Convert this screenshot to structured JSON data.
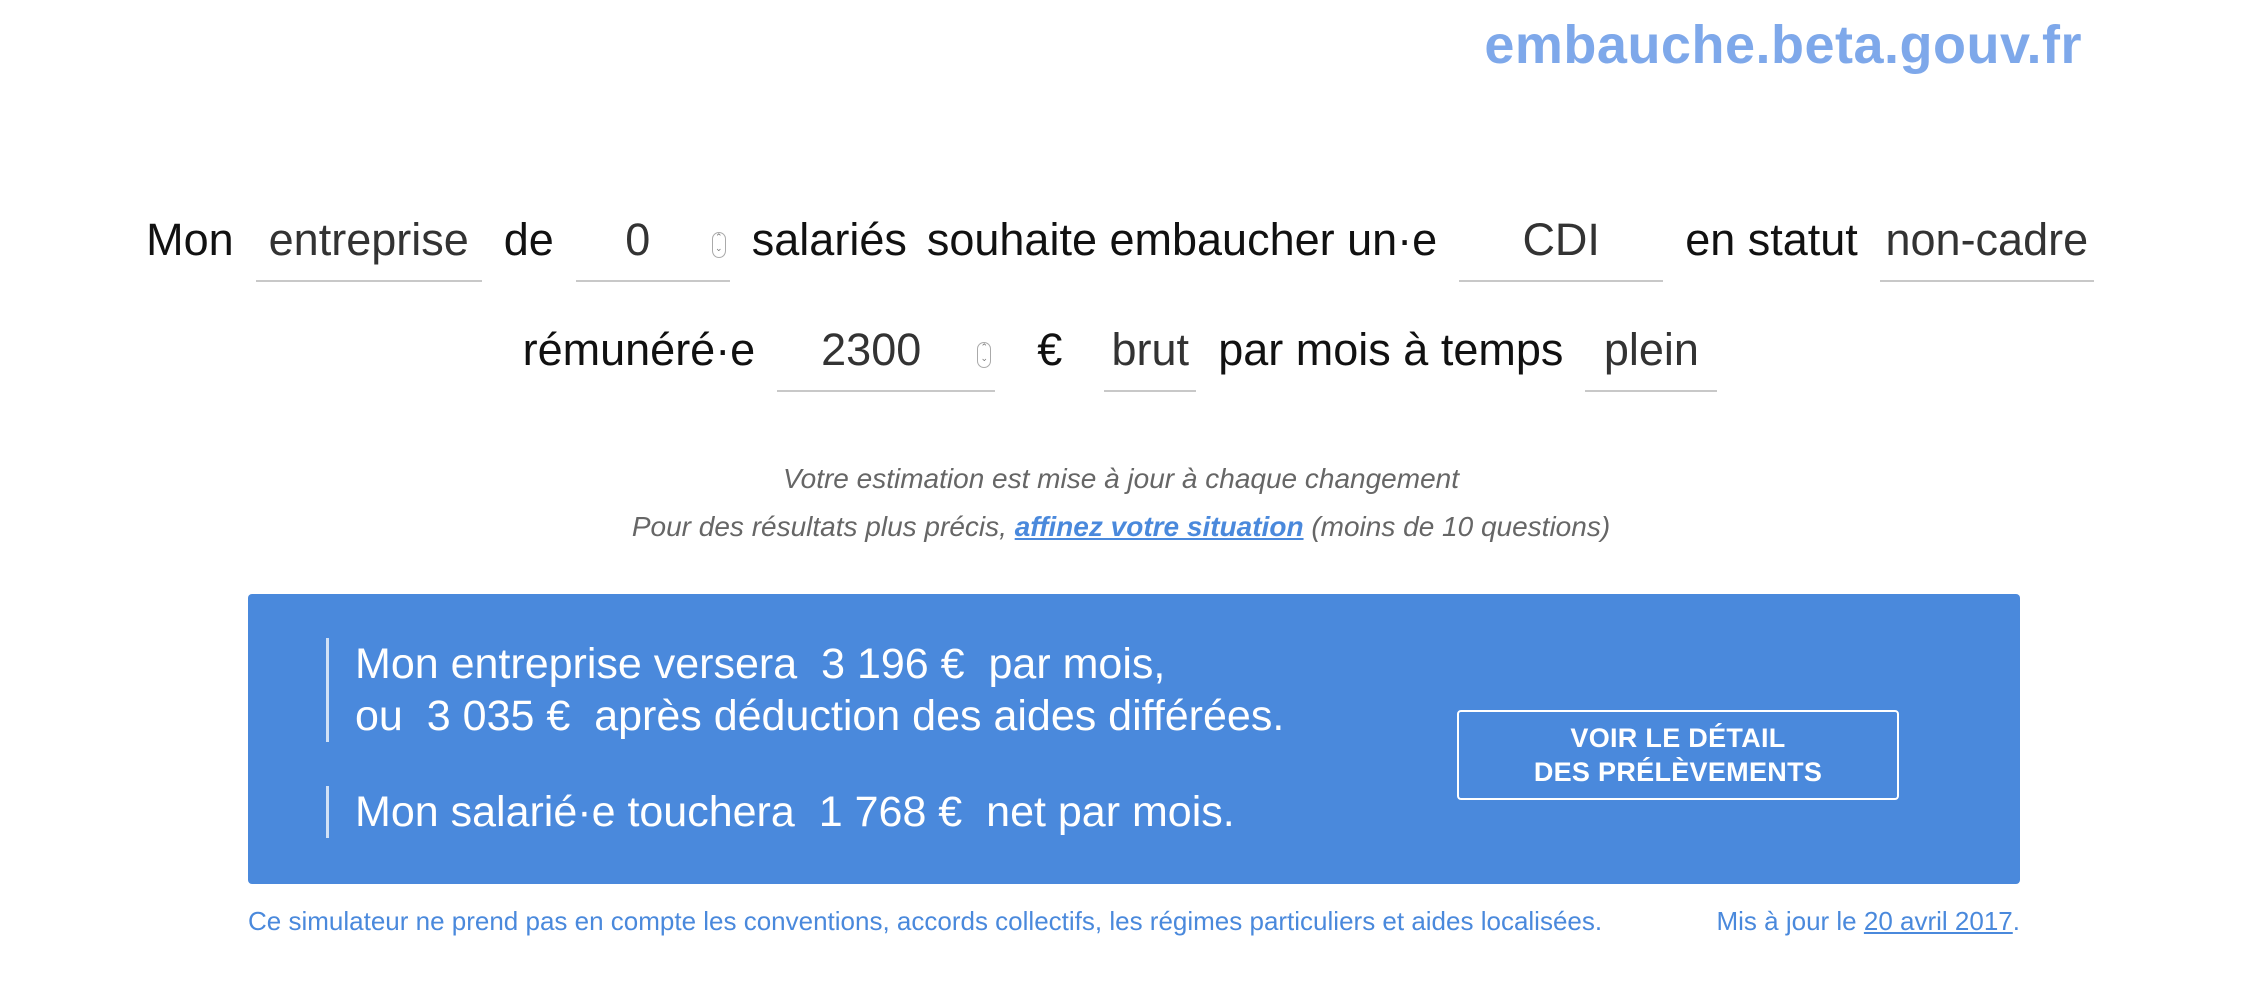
{
  "header": {
    "site_link": "embauche.beta.gouv.fr"
  },
  "sentence": {
    "mon": "Mon",
    "company_type": "entreprise",
    "de": "de",
    "employees": "0",
    "salaries": "salariés",
    "souhaite": "souhaite embaucher un·e",
    "contract": "CDI",
    "en_statut": "en statut",
    "status": "non-cadre",
    "remunere": "rémunéré·e",
    "salary": "2300",
    "currency": "€",
    "salary_type": "brut",
    "par_mois": "par mois à temps",
    "time": "plein"
  },
  "notes": {
    "line1": "Votre estimation est mise à jour à chaque changement",
    "line2_before": "Pour des résultats plus précis,",
    "line2_link": "affinez votre situation",
    "line2_after": "(moins de 10 questions)"
  },
  "result": {
    "line1_prefix": "Mon entreprise versera",
    "line1_amount": "3 196 €",
    "line1_suffix": "par mois,",
    "line2_prefix": "ou",
    "line2_amount": "3 035 €",
    "line2_suffix": "après déduction des aides différées.",
    "line3_prefix": "Mon salarié·e touchera",
    "line3_amount": "1 768 €",
    "line3_suffix": "net par mois.",
    "button_line1": "VOIR LE DÉTAIL",
    "button_line2": "DES PRÉLÈVEMENTS",
    "accent_color": "#4a89dc"
  },
  "footer": {
    "disclaimer": "Ce simulateur ne prend pas en compte les conventions, accords collectifs, les régimes particuliers et aides localisées.",
    "updated_prefix": "Mis à jour le",
    "updated_date": "20 avril 2017",
    "updated_suffix": "."
  }
}
